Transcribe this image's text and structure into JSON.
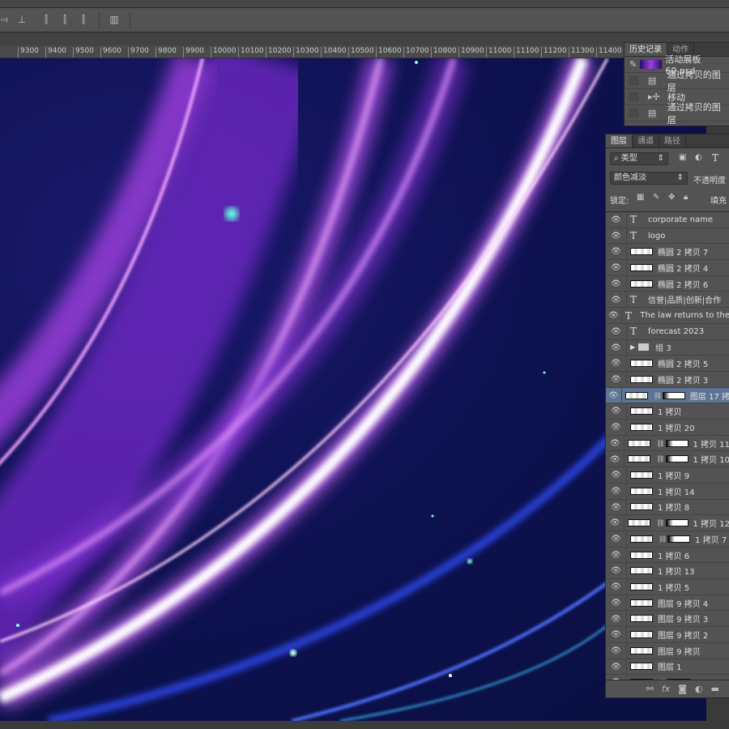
{
  "ruler": {
    "labels": [
      "9300",
      "9400",
      "9500",
      "9600",
      "9700",
      "9800",
      "9900",
      "10000",
      "10100",
      "10200",
      "10300",
      "10400",
      "10500",
      "10600",
      "10700",
      "10800",
      "10900",
      "11000",
      "11100",
      "11200",
      "11300",
      "11400"
    ]
  },
  "history": {
    "tabs": [
      "历史记录",
      "动作"
    ],
    "snapshot": "活动展板60.psd",
    "items": [
      {
        "icon": "document-icon",
        "label": "通过拷贝的图层"
      },
      {
        "icon": "move-icon",
        "label": "移动"
      },
      {
        "icon": "document-icon",
        "label": "通过拷贝的图层"
      }
    ]
  },
  "layers": {
    "tabs": [
      "图层",
      "通道",
      "路径"
    ],
    "filter": "类型",
    "blend_mode": "颜色减淡",
    "opacity_label": "不透明度",
    "lock_label": "锁定:",
    "fill_label": "填充",
    "items": [
      {
        "type": "text",
        "name": "corporate name"
      },
      {
        "type": "text",
        "name": "logo"
      },
      {
        "type": "pixel",
        "name": "椭圆 2 拷贝 7"
      },
      {
        "type": "pixel",
        "name": "椭圆 2 拷贝 4"
      },
      {
        "type": "pixel",
        "name": "椭圆 2 拷贝 6"
      },
      {
        "type": "text",
        "name": "信誉|品质|创新|合作"
      },
      {
        "type": "text",
        "name": "The law returns to the"
      },
      {
        "type": "text",
        "name": "forecast 2023"
      },
      {
        "type": "group",
        "name": "组 3"
      },
      {
        "type": "pixel",
        "name": "椭圆 2 拷贝 5"
      },
      {
        "type": "pixel",
        "name": "椭圆 2 拷贝 3"
      },
      {
        "type": "mask",
        "name": "图层 17 拷",
        "selected": true
      },
      {
        "type": "pixel",
        "name": "1 拷贝"
      },
      {
        "type": "pixel",
        "name": "1 拷贝 20"
      },
      {
        "type": "mask",
        "name": "1 拷贝 11"
      },
      {
        "type": "mask",
        "name": "1 拷贝 10"
      },
      {
        "type": "pixel",
        "name": "1 拷贝 9"
      },
      {
        "type": "pixel",
        "name": "1 拷贝 14"
      },
      {
        "type": "pixel",
        "name": "1 拷贝 8"
      },
      {
        "type": "mask",
        "name": "1 拷贝 12"
      },
      {
        "type": "mask",
        "name": "1 拷贝 7"
      },
      {
        "type": "pixel",
        "name": "1 拷贝 6"
      },
      {
        "type": "pixel",
        "name": "1 拷贝 13"
      },
      {
        "type": "pixel",
        "name": "1 拷贝 5"
      },
      {
        "type": "pixel",
        "name": "图层 9 拷贝 4"
      },
      {
        "type": "pixel",
        "name": "图层 9 拷贝 3"
      },
      {
        "type": "pixel",
        "name": "图层 9 拷贝 2"
      },
      {
        "type": "pixel",
        "name": "图层 9 拷贝"
      },
      {
        "type": "pixel",
        "name": "图层 1"
      },
      {
        "type": "mask",
        "name": ""
      }
    ],
    "footer_icons": [
      "link-icon",
      "fx-icon",
      "add-mask-icon",
      "adjustment-icon",
      "new-group-icon"
    ]
  },
  "colors": {
    "canvas_bg": "#0d1150",
    "streak_purple": "#a040e0",
    "streak_pink": "#e080ff",
    "streak_blue": "#3050ff"
  }
}
